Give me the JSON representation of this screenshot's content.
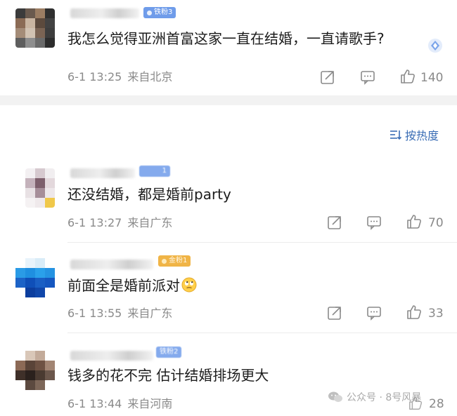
{
  "colors": {
    "accent_blue": "#3a6db5",
    "meta_gray": "#8a8a8a",
    "fan_blue": "#6f9cea",
    "fan_gold": "#f0b446"
  },
  "sort_label": "按热度",
  "comments": [
    {
      "fan_badge": "铁粉3",
      "text": "我怎么觉得亚洲首富这家一直在结婚，一直请歌手?",
      "time": "6-1 13:25",
      "location": "来自北京",
      "likes": "140"
    },
    {
      "fan_badge": "1",
      "text": "还没结婚，都是婚前party",
      "time": "6-1 13:27",
      "location": "来自广东",
      "likes": "70"
    },
    {
      "fan_badge": "金粉1",
      "text": "前面全是婚前派对",
      "time": "6-1 13:55",
      "location": "来自广东",
      "likes": "33"
    },
    {
      "fan_badge": "铁粉2",
      "text": "钱多的花不完 估计结婚排场更大",
      "time": "6-1 13:44",
      "location": "来自河南",
      "likes": "28"
    }
  ],
  "watermark": {
    "source": "公众号 · 8号风暴"
  },
  "icons": {
    "share": "share-icon",
    "reply": "comment-icon",
    "like": "thumbs-up-icon",
    "sort": "sort-icon",
    "emoji": "rolling-eyes-emoji-icon",
    "wechat": "wechat-icon"
  }
}
